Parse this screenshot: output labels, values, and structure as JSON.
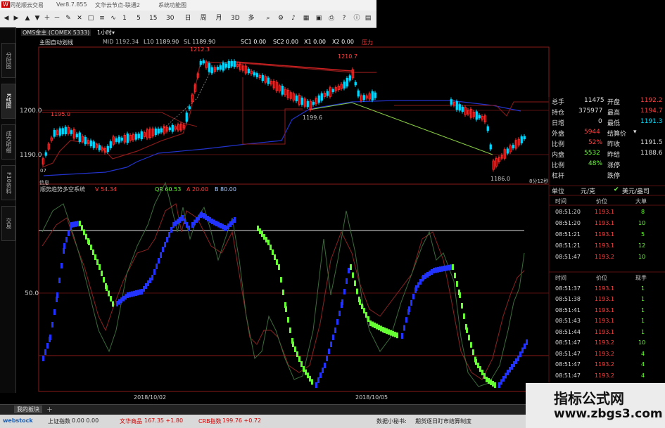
{
  "titlebar": {
    "app": "同花顺云交易",
    "version": "Ver8.7.855",
    "node": "文华云节点-联通2",
    "menu": "系统功能图"
  },
  "toolbar": {
    "periods": [
      "1",
      "5",
      "15",
      "30",
      "日",
      "周",
      "月",
      "3D",
      "多"
    ]
  },
  "left_nav": [
    "分时图",
    "K线图",
    "成交明细",
    "F10资料",
    "交易"
  ],
  "symbol": {
    "name": "OMS金主 (COMEX 5333)",
    "period": "1小时"
  },
  "indicator_bar": {
    "name": "主图自动划线",
    "items": [
      "MID 1192.34",
      "L10 1189.90",
      "SL 1189.90",
      "SC1 0.00",
      "SC2 0.00",
      "X1 0.00",
      "X2 0.00",
      "压力"
    ]
  },
  "main_chart": {
    "y_labels": [
      "1200.0",
      "1190.0"
    ],
    "price_labels": {
      "high1": "1212.3",
      "high2": "1210.7",
      "low1": "1199.6",
      "low2": "1186.0",
      "left_mark": "1195.0",
      "start": "07"
    },
    "time_label": "8分12秒"
  },
  "sub_indicator": {
    "name": "顺势趋势多空系统",
    "v": "V 54.34",
    "qr": "QR 60.53",
    "a": "A 20.00",
    "b": "B 80.00",
    "y_label": "50.0"
  },
  "x_axis": {
    "left_date": "2018/10/02",
    "right_date": "2018/10/05",
    "corner": "信息"
  },
  "quote": {
    "rows": [
      {
        "l": "总手",
        "lv": "11475",
        "r": "开盘",
        "rv": "1192.2"
      },
      {
        "l": "持仓",
        "lv": "375977",
        "r": "最高",
        "rv": "1194.7"
      },
      {
        "l": "日增",
        "lv": "0",
        "r": "最低",
        "rv": "1191.3"
      },
      {
        "l": "外盘",
        "lv": "5944",
        "r": "结算价",
        "rv": ""
      },
      {
        "l": "比例",
        "lv": "52%",
        "r": "昨收",
        "rv": "1191.5"
      },
      {
        "l": "内盘",
        "lv": "5532",
        "r": "昨结",
        "rv": "1188.6"
      },
      {
        "l": "比例",
        "lv": "48%",
        "r": "涨停",
        "rv": ""
      },
      {
        "l": "杠杆",
        "lv": "",
        "r": "跌停",
        "rv": ""
      }
    ],
    "unit_label": "单位",
    "unit_value": "元/克",
    "currency": "美元/盎司"
  },
  "trades1": {
    "headers": [
      "时间",
      "价位",
      "大单"
    ],
    "rows": [
      {
        "t": "08:51:20",
        "p": "1193.1",
        "v": "8"
      },
      {
        "t": "08:51:20",
        "p": "1193.1",
        "v": "10"
      },
      {
        "t": "08:51:21",
        "p": "1193.1",
        "v": "5"
      },
      {
        "t": "08:51:21",
        "p": "1193.1",
        "v": "12"
      },
      {
        "t": "08:51:47",
        "p": "1193.2",
        "v": "10"
      }
    ]
  },
  "trades2": {
    "headers": [
      "时间",
      "价位",
      "现手"
    ],
    "rows": [
      {
        "t": "08:51:37",
        "p": "1193.1",
        "v": "1"
      },
      {
        "t": "08:51:38",
        "p": "1193.1",
        "v": "1"
      },
      {
        "t": "08:51:41",
        "p": "1193.1",
        "v": "1"
      },
      {
        "t": "08:51:43",
        "p": "1193.1",
        "v": "1"
      },
      {
        "t": "08:51:44",
        "p": "1193.1",
        "v": "1"
      },
      {
        "t": "08:51:47",
        "p": "1193.2",
        "v": "10"
      },
      {
        "t": "08:51:47",
        "p": "1193.2",
        "v": "4"
      },
      {
        "t": "08:51:47",
        "p": "1193.2",
        "v": "4"
      },
      {
        "t": "08:51:47",
        "p": "1193.2",
        "v": "4"
      }
    ]
  },
  "bottom_tab": "我的板块",
  "status": {
    "brand": "webstock",
    "items": [
      {
        "label": "上证指数",
        "value": "0.00  0.00"
      },
      {
        "label": "文华商品",
        "value": "167.35  +1.80"
      },
      {
        "label": "CRB指数",
        "value": "199.76  +0.72"
      }
    ],
    "right": "数据小秘书:",
    "right2": "期货逐日盯市结算制度"
  },
  "watermark": {
    "title": "指标公式网",
    "url": "www.zbgs3.com"
  },
  "colors": {
    "up": "#ff3030",
    "down": "#00e0ff",
    "green": "#66ff33",
    "blue": "#2222ff",
    "darkred": "#8b1a1a"
  }
}
